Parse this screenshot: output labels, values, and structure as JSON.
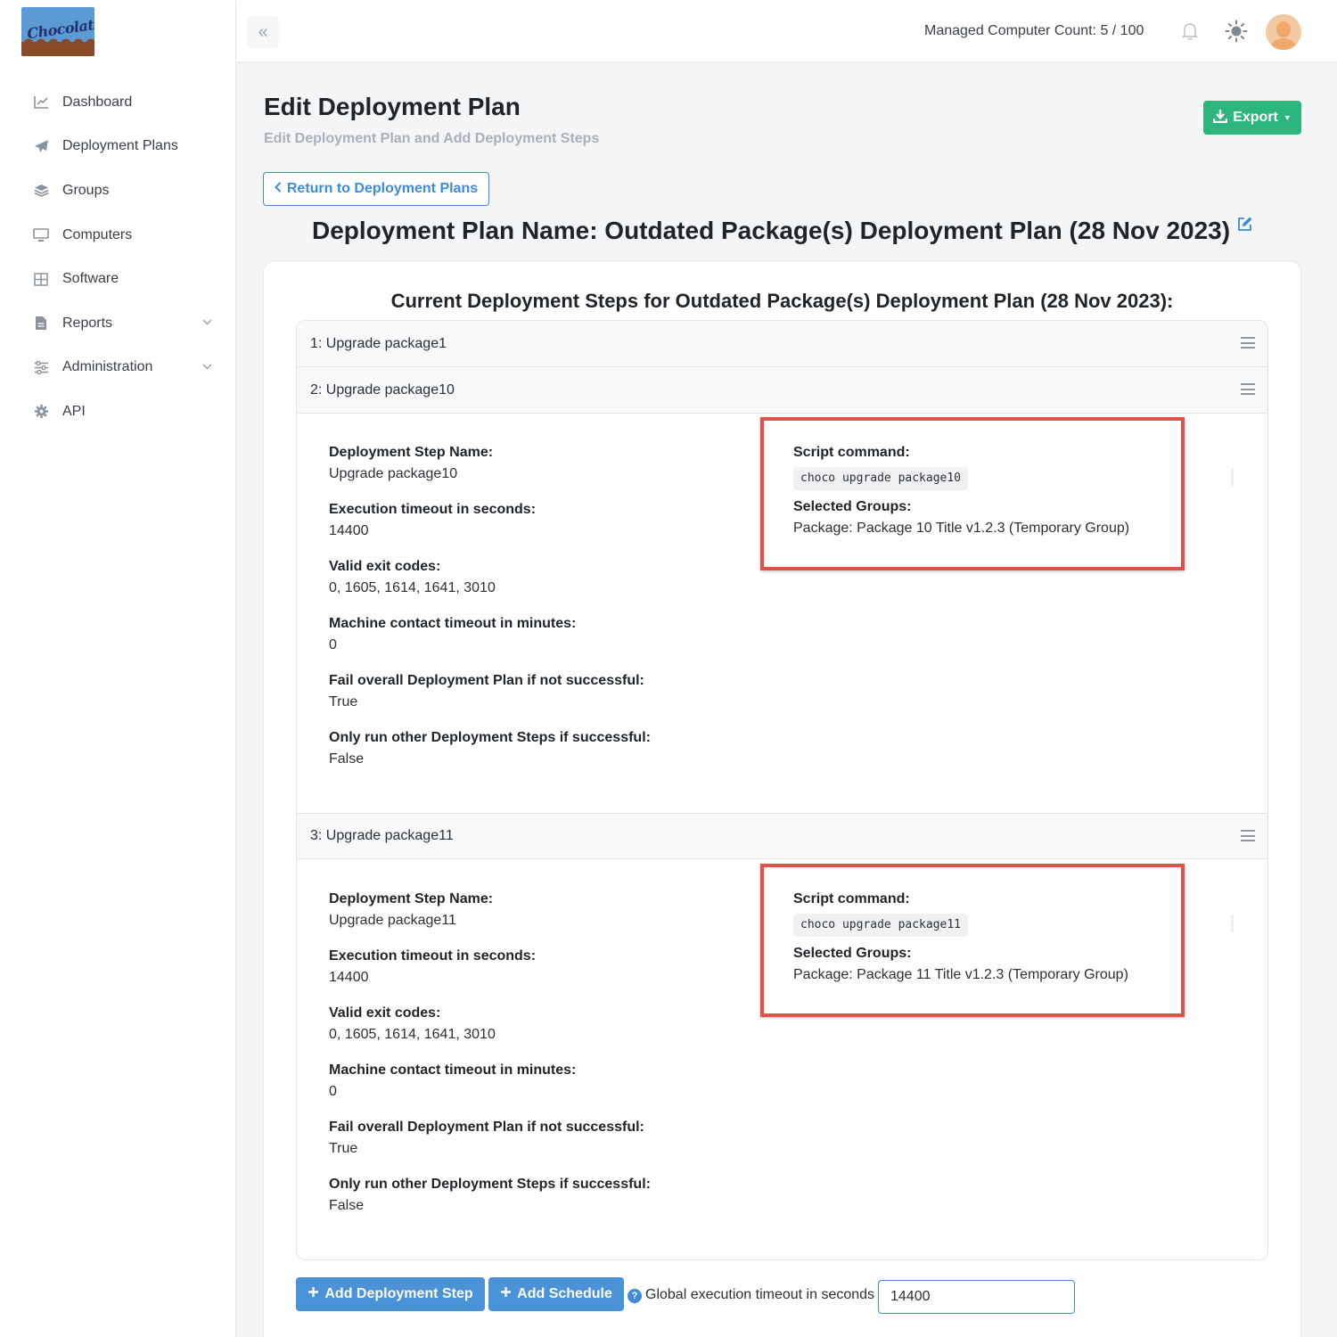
{
  "app": {
    "logo_text": "Chocolatey"
  },
  "sidebar": {
    "items": [
      {
        "label": "Dashboard",
        "icon": "chart-line-icon"
      },
      {
        "label": "Deployment Plans",
        "icon": "paper-plane-icon"
      },
      {
        "label": "Groups",
        "icon": "layers-icon"
      },
      {
        "label": "Computers",
        "icon": "desktop-icon"
      },
      {
        "label": "Software",
        "icon": "grid-icon"
      },
      {
        "label": "Reports",
        "icon": "file-icon",
        "has_chevron": true
      },
      {
        "label": "Administration",
        "icon": "sliders-icon",
        "has_chevron": true
      },
      {
        "label": "API",
        "icon": "gear-icon"
      }
    ]
  },
  "topbar": {
    "managed_count_label": "Managed Computer Count: 5 / 100",
    "collapse_icon": "«"
  },
  "header": {
    "title": "Edit Deployment Plan",
    "subtitle": "Edit Deployment Plan and Add Deployment Steps",
    "export_label": "Export",
    "return_label": "Return to Deployment Plans",
    "plan_name": "Deployment Plan Name: Outdated Package(s) Deployment Plan (28 Nov 2023)"
  },
  "steps_section": {
    "heading": "Current Deployment Steps for Outdated Package(s) Deployment Plan (28 Nov 2023):",
    "labels": {
      "name": "Deployment Step Name:",
      "timeout": "Execution timeout in seconds:",
      "exit_codes": "Valid exit codes:",
      "contact_timeout": "Machine contact timeout in minutes:",
      "fail_overall": "Fail overall Deployment Plan if not successful:",
      "only_run": "Only run other Deployment Steps if successful:",
      "script": "Script command:",
      "groups": "Selected Groups:"
    },
    "steps": [
      {
        "header": "1: Upgrade package1"
      },
      {
        "header": "2: Upgrade package10",
        "name": "Upgrade package10",
        "timeout": "14400",
        "exit_codes": "0, 1605, 1614, 1641, 3010",
        "contact_timeout": "0",
        "fail_overall": "True",
        "only_run": "False",
        "script": "choco upgrade package10",
        "groups": "Package: Package 10 Title v1.2.3 (Temporary Group)"
      },
      {
        "header": "3: Upgrade package11",
        "name": "Upgrade package11",
        "timeout": "14400",
        "exit_codes": "0, 1605, 1614, 1641, 3010",
        "contact_timeout": "0",
        "fail_overall": "True",
        "only_run": "False",
        "script": "choco upgrade package11",
        "groups": "Package: Package 11 Title v1.2.3 (Temporary Group)"
      }
    ]
  },
  "footer": {
    "add_step_label": "Add Deployment Step",
    "add_schedule_label": "Add Schedule",
    "global_timeout_label": "Global execution timeout in seconds",
    "global_timeout_value": "14400"
  },
  "colors": {
    "accent": "#3d8bd9",
    "export": "#2cb67d",
    "highlight": "#e35049"
  }
}
